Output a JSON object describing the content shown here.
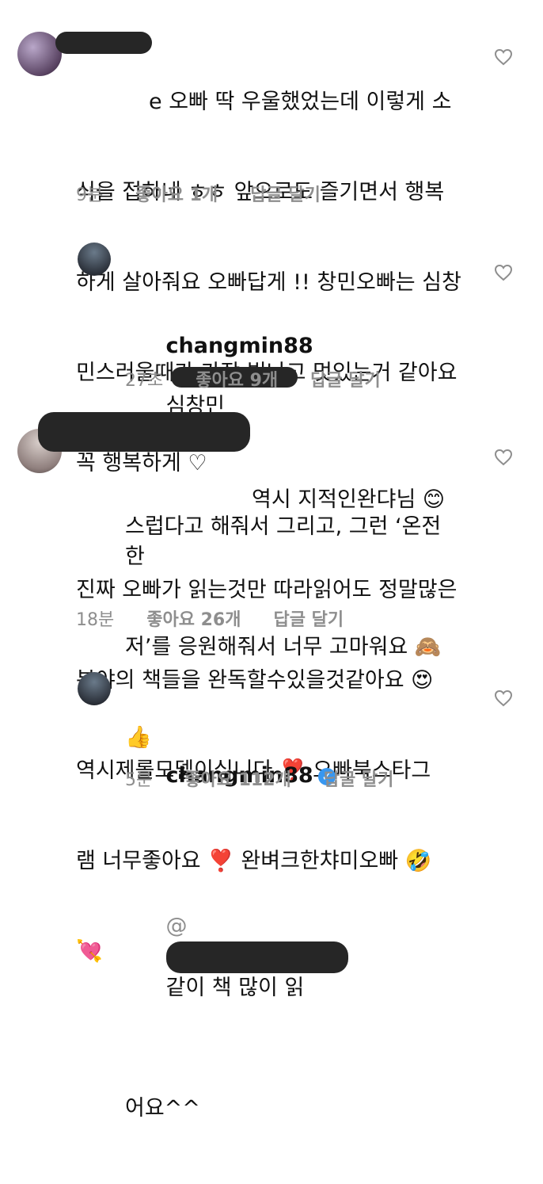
{
  "comments": [
    {
      "lines": [
        "e 오빠 딱 우울했었는데 이렇게 소",
        "식을 접하네 ㅎㅎ 앞으로도 즐기면서 행복",
        "하게 살아줘요 오빠답게 !! 창민오빠는 심창",
        "민스러울때가 가장 빛나고 멋있는거 같아요",
        "꼭 행복하게 ♡"
      ],
      "time": "9분",
      "likes": "좋아요 1개",
      "reply": "답글 달기"
    },
    {
      "username": "changmin88",
      "lines": [
        "심창민",
        "스럽다고 해줘서 그리고, 그런 ‘온전한",
        "저’를 응원해줘서 너무 고마워요 🙈",
        "👍"
      ],
      "time": "27초",
      "likes": "좋아요 9개",
      "reply": "답글 달기"
    },
    {
      "lines": [
        "역시 지적인완댜님 😊",
        "진짜 오빠가 읽는것만 따라읽어도 정말많은",
        "분야의 책들을 완독할수있을것같아요 😍",
        "역시제롤모델이십니다 ❣️ 오빠북스타그",
        "램 너무좋아요 ❣️ 완벼크한챠미오빠 🤣",
        "💘"
      ],
      "time": "18분",
      "likes": "좋아요 26개",
      "reply": "답글 달기"
    },
    {
      "username": "changmin88",
      "lines": [
        "@",
        "같이 책 많이 읽",
        "어요^^"
      ],
      "time": "5분",
      "likes": "좋아요 112개",
      "reply": "답글 달기"
    }
  ]
}
